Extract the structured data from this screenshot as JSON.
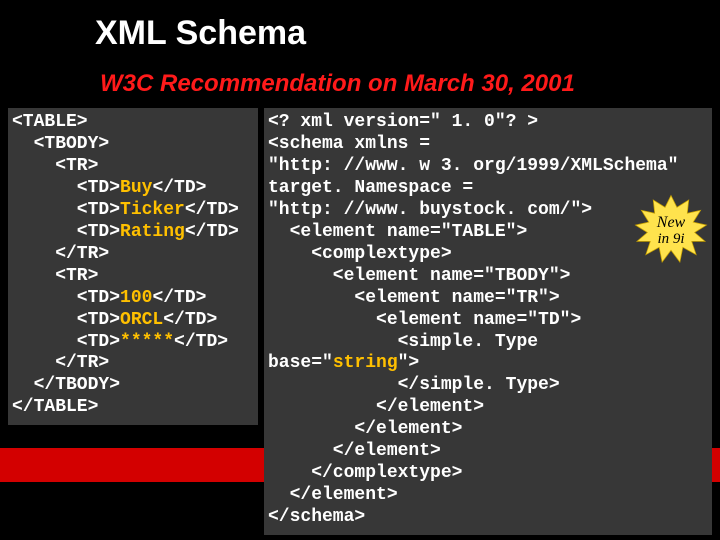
{
  "title": "XML Schema",
  "subtitle": "W3C Recommendation on March 30, 2001",
  "burst": {
    "line1": "New",
    "line2": "in 9i"
  },
  "left_code": {
    "l1": "<TABLE>",
    "l2": "  <TBODY>",
    "l3": "    <TR>",
    "l4a": "      <TD>",
    "l4b": "Buy",
    "l4c": "</TD>",
    "l5a": "      <TD>",
    "l5b": "Ticker",
    "l5c": "</TD>",
    "l6a": "      <TD>",
    "l6b": "Rating",
    "l6c": "</TD>",
    "l7": "    </TR>",
    "l8": "    <TR>",
    "l9a": "      <TD>",
    "l9b": "100",
    "l9c": "</TD>",
    "l10a": "      <TD>",
    "l10b": "ORCL",
    "l10c": "</TD>",
    "l11a": "      <TD>",
    "l11b": "*****",
    "l11c": "</TD>",
    "l12": "    </TR>",
    "l13": "  </TBODY>",
    "l14": "</TABLE>"
  },
  "right_code": {
    "r1": "<? xml version=\" 1. 0\"? >",
    "r2": "<schema xmlns =",
    "r3": "\"http: //www. w 3. org/1999/XMLSchema\"",
    "r4": "target. Namespace =",
    "r5": "\"http: //www. buystock. com/\">",
    "r6": "  <element name=\"TABLE\">",
    "r7": "    <complextype>",
    "r8": "      <element name=\"TBODY\">",
    "r9": "        <element name=\"TR\">",
    "r10": "          <element name=\"TD\">",
    "r11": "            <simple. Type",
    "r12a": "base=\"",
    "r12b": "string",
    "r12c": "\">",
    "r13": "            </simple. Type>",
    "r14": "          </element>",
    "r15": "        </element>",
    "r16": "      </element>",
    "r17": "    </complextype>",
    "r18": "  </element>",
    "r19": "</schema>"
  }
}
